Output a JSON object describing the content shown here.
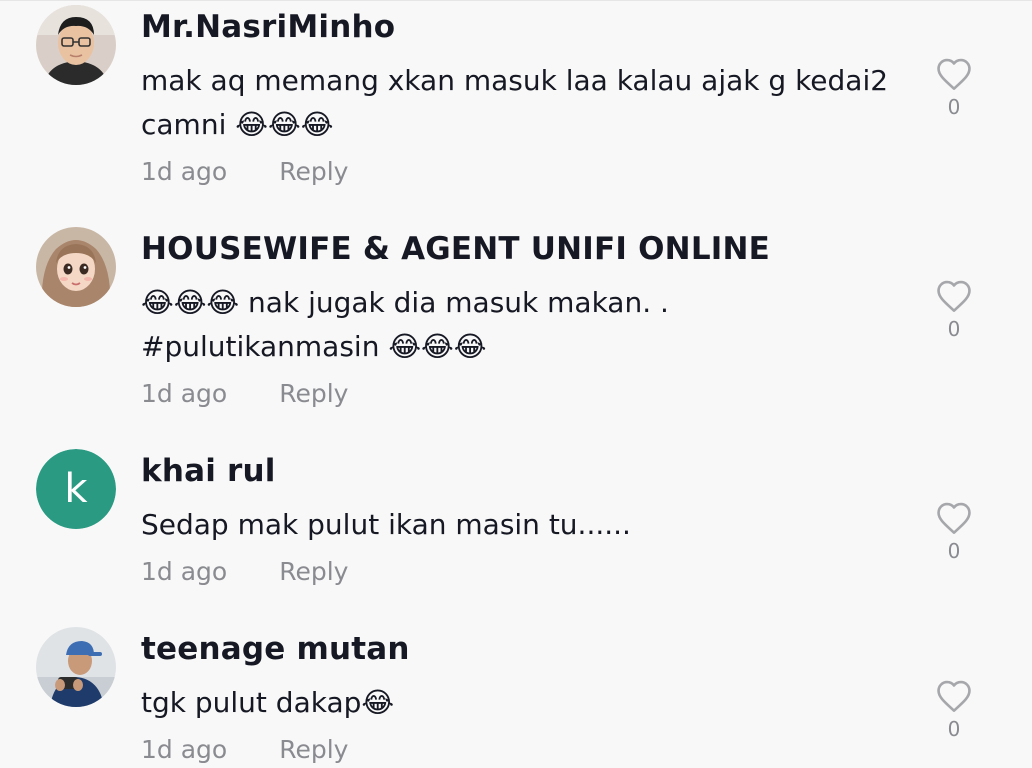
{
  "comments": [
    {
      "username": "Mr.NasriMinho",
      "text": "mak aq memang xkan masuk laa kalau ajak g kedai2 camni 😂😂😂",
      "time": "1d ago",
      "reply_label": "Reply",
      "likes": "0",
      "avatar_icon": "user-photo-glasses-icon"
    },
    {
      "username": "HOUSEWIFE & AGENT UNIFI ONLINE",
      "text": "😂😂😂 nak jugak dia masuk makan. . #pulutikanmasin 😂😂😂",
      "time": "1d ago",
      "reply_label": "Reply",
      "likes": "0",
      "avatar_icon": "cartoon-hijab-avatar-icon"
    },
    {
      "username": "khai rul",
      "text": "Sedap mak pulut ikan masin tu......",
      "time": "1d ago",
      "reply_label": "Reply",
      "likes": "0",
      "avatar_letter": "k",
      "avatar_color": "#2a9a82"
    },
    {
      "username": "teenage mutan",
      "text": "tgk pulut dakap😂",
      "time": "1d ago",
      "reply_label": "Reply",
      "likes": "0",
      "avatar_icon": "user-photo-cap-icon"
    }
  ],
  "colors": {
    "background": "#f8f8f8",
    "text_primary": "#161823",
    "text_secondary": "#8a8b91"
  },
  "icons": {
    "like": "heart-outline-icon"
  }
}
